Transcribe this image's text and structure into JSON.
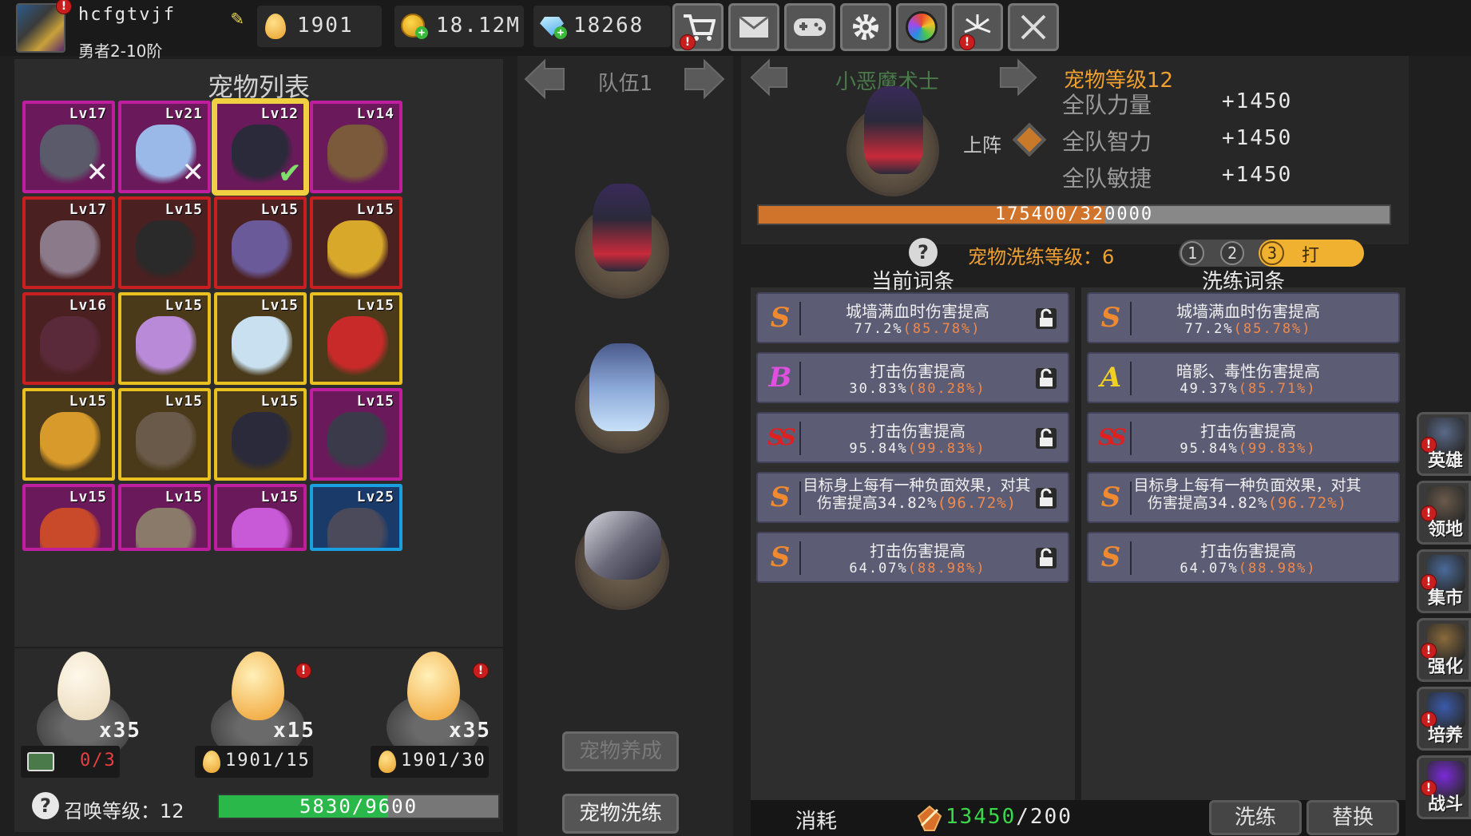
{
  "player": {
    "name": "hcfgtvjf",
    "rank": "勇者2-10阶"
  },
  "resources": {
    "egg_shards": "1901",
    "gold": "18.12M",
    "diamonds": "18268"
  },
  "toolbar": {
    "icons": [
      "cart-icon",
      "mail-icon",
      "gamepad-icon",
      "gear-icon",
      "shutter-icon",
      "fireworks-icon",
      "swords-icon"
    ]
  },
  "pet_list": {
    "title": "宠物列表",
    "pets": [
      {
        "level": "Lv17",
        "rarity": "epic",
        "mark": "x",
        "color": "#5a5a6a"
      },
      {
        "level": "Lv21",
        "rarity": "epic",
        "mark": "x",
        "color": "#9ab8e8"
      },
      {
        "level": "Lv12",
        "rarity": "epic",
        "mark": "check",
        "color": "#2a2a3a"
      },
      {
        "level": "Lv14",
        "rarity": "epic",
        "mark": "",
        "color": "#7a5a3a"
      },
      {
        "level": "Lv17",
        "rarity": "red",
        "mark": "",
        "color": "#8a7a8a"
      },
      {
        "level": "Lv15",
        "rarity": "red",
        "mark": "",
        "color": "#2a2a2a"
      },
      {
        "level": "Lv15",
        "rarity": "red",
        "mark": "",
        "color": "#6a5a9a"
      },
      {
        "level": "Lv15",
        "rarity": "red",
        "mark": "",
        "color": "#d8a82a"
      },
      {
        "level": "Lv16",
        "rarity": "red",
        "mark": "",
        "color": "#5a2a3a"
      },
      {
        "level": "Lv15",
        "rarity": "gold",
        "mark": "",
        "color": "#b88ad8"
      },
      {
        "level": "Lv15",
        "rarity": "gold",
        "mark": "",
        "color": "#c8e0f0"
      },
      {
        "level": "Lv15",
        "rarity": "gold",
        "mark": "",
        "color": "#c82a2a"
      },
      {
        "level": "Lv15",
        "rarity": "gold",
        "mark": "",
        "color": "#d89a2a"
      },
      {
        "level": "Lv15",
        "rarity": "gold",
        "mark": "",
        "color": "#6a5a4a"
      },
      {
        "level": "Lv15",
        "rarity": "gold",
        "mark": "",
        "color": "#2a2a3a"
      },
      {
        "level": "Lv15",
        "rarity": "epic",
        "mark": "",
        "color": "#3a3a4a"
      },
      {
        "level": "Lv15",
        "rarity": "epic",
        "mark": "",
        "color": "#c84a2a"
      },
      {
        "level": "Lv15",
        "rarity": "epic",
        "mark": "",
        "color": "#8a7a6a"
      },
      {
        "level": "Lv15",
        "rarity": "epic",
        "mark": "",
        "color": "#c85ad8"
      },
      {
        "level": "Lv25",
        "rarity": "blue",
        "mark": "",
        "color": "#4a4a5a"
      }
    ]
  },
  "eggs": [
    {
      "count": "x35",
      "cost": "0/3",
      "cost_type": "video",
      "kind": "plain"
    },
    {
      "count": "x15",
      "cost": "1901/15",
      "cost_type": "egg",
      "kind": "gold"
    },
    {
      "count": "x35",
      "cost": "1901/30",
      "cost_type": "egg",
      "kind": "gold"
    }
  ],
  "summon": {
    "label": "召唤等级：12",
    "progress_text": "5830/9600",
    "progress": 0.607
  },
  "team": {
    "title": "队伍1",
    "pet_colors": [
      "#3a2a3a",
      "#8aa8d8",
      "#6a6a7a"
    ],
    "buttons": {
      "nurture": "宠物养成",
      "refine": "宠物洗练"
    }
  },
  "pet_detail": {
    "name": "小恶魔术士",
    "level_label": "宠物等级12",
    "deploy_label": "上阵",
    "stats": [
      {
        "label": "全队力量",
        "value": "+1450"
      },
      {
        "label": "全队智力",
        "value": "+1450"
      },
      {
        "label": "全队敏捷",
        "value": "+1450"
      }
    ],
    "xp_text": "175400/320000",
    "xp_progress": 0.548
  },
  "refine": {
    "level_label": "宠物洗练等级：",
    "level_value": "6",
    "stages": [
      "1",
      "2",
      "3"
    ],
    "stage_action": "打",
    "current_header": "当前词条",
    "new_header": "洗练词条",
    "current": [
      {
        "grade": "S",
        "title": "城墙满血时伤害提高",
        "value": "77.2%",
        "max": "(85.78%)"
      },
      {
        "grade": "B",
        "title": "打击伤害提高",
        "value": "30.83%",
        "max": "(80.28%)"
      },
      {
        "grade": "SS",
        "title": "打击伤害提高",
        "value": "95.84%",
        "max": "(99.83%)"
      },
      {
        "grade": "S",
        "title": "目标身上每有一种负面效果，对其伤害提高",
        "value": "34.82%",
        "max": "(96.72%)"
      },
      {
        "grade": "S",
        "title": "打击伤害提高",
        "value": "64.07%",
        "max": "(88.98%)"
      }
    ],
    "new": [
      {
        "grade": "S",
        "title": "城墙满血时伤害提高",
        "value": "77.2%",
        "max": "(85.78%)"
      },
      {
        "grade": "A",
        "title": "暗影、毒性伤害提高",
        "value": "49.37%",
        "max": "(85.71%)"
      },
      {
        "grade": "SS",
        "title": "打击伤害提高",
        "value": "95.84%",
        "max": "(99.83%)"
      },
      {
        "grade": "S",
        "title": "目标身上每有一种负面效果，对其伤害提高",
        "value": "34.82%",
        "max": "(96.72%)"
      },
      {
        "grade": "S",
        "title": "打击伤害提高",
        "value": "64.07%",
        "max": "(88.98%)"
      }
    ],
    "cost_label": "消耗",
    "cost_value": "13450",
    "cost_required": "/200",
    "btn_refine": "洗练",
    "btn_replace": "替换"
  },
  "side_nav": [
    {
      "label": "英雄",
      "color": "#5a6a8a"
    },
    {
      "label": "领地",
      "color": "#6a5a4a"
    },
    {
      "label": "集市",
      "color": "#4a6a9a"
    },
    {
      "label": "强化",
      "color": "#8a6a3a"
    },
    {
      "label": "培养",
      "color": "#3a5aaa"
    },
    {
      "label": "战斗",
      "color": "#7a2ad8"
    }
  ],
  "colors": {
    "rarity_epic": "#c01ea0",
    "rarity_red": "#c82020",
    "rarity_gold": "#e8c020",
    "rarity_blue": "#1aa0e0",
    "grade_S": "#f08a30",
    "grade_A": "#f0d020",
    "grade_B": "#e050e0",
    "grade_SS": "#e02020",
    "accent_orange": "#f0a030",
    "progress_green": "#2ab84a"
  }
}
